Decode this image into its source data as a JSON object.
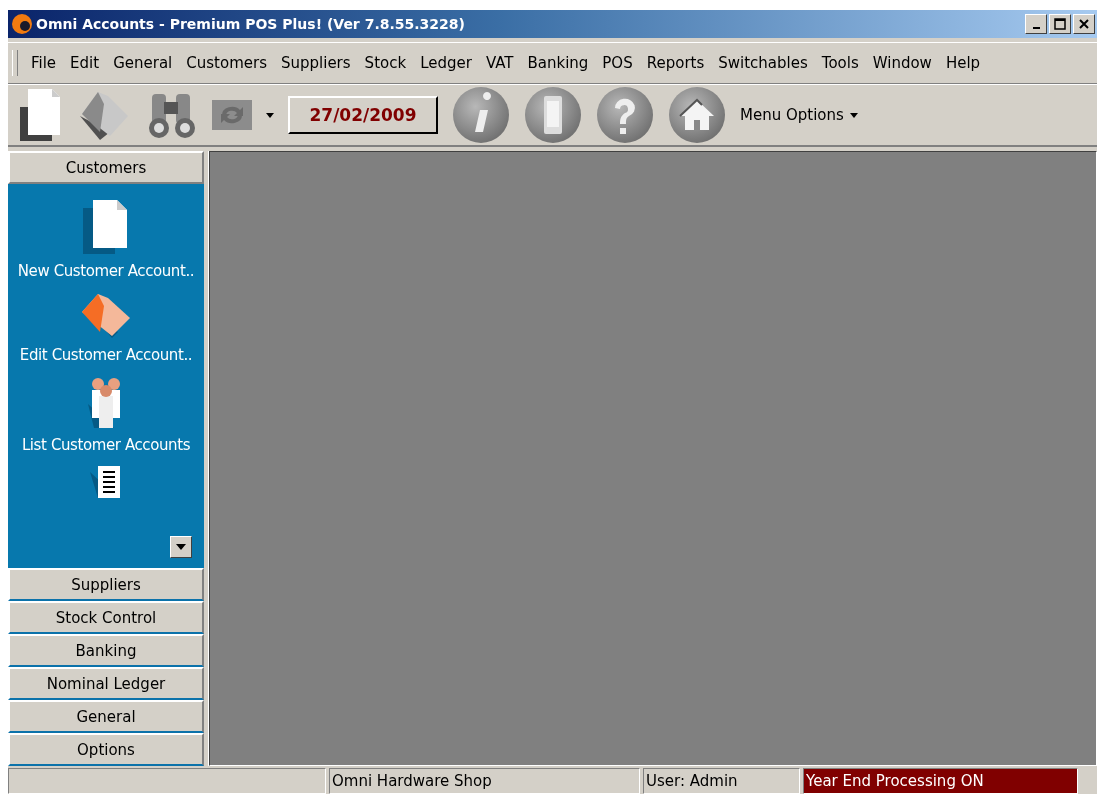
{
  "window": {
    "title": "Omni Accounts - Premium POS Plus!  (Ver 7.8.55.3228)"
  },
  "menu": [
    "File",
    "Edit",
    "General",
    "Customers",
    "Suppliers",
    "Stock",
    "Ledger",
    "VAT",
    "Banking",
    "POS",
    "Reports",
    "Switchables",
    "Tools",
    "Window",
    "Help"
  ],
  "toolbar": {
    "date": "27/02/2009",
    "menu_options": "Menu Options"
  },
  "sidebar": {
    "groups": [
      {
        "label": "Customers",
        "expanded": true,
        "items": [
          {
            "label": "New Customer Account..",
            "kind": "new"
          },
          {
            "label": "Edit Customer Account..",
            "kind": "edit"
          },
          {
            "label": "List Customer Accounts",
            "kind": "list"
          }
        ]
      },
      {
        "label": "Suppliers",
        "expanded": false
      },
      {
        "label": "Stock Control",
        "expanded": false
      },
      {
        "label": "Banking",
        "expanded": false
      },
      {
        "label": "Nominal Ledger",
        "expanded": false
      },
      {
        "label": "General",
        "expanded": false
      },
      {
        "label": "Options",
        "expanded": false
      }
    ]
  },
  "status_bar": [
    {
      "text": "Omni Hardware Shop",
      "kind": "plain"
    },
    {
      "text": "User: Admin",
      "kind": "plain"
    },
    {
      "text": "Year End Processing ON",
      "kind": "alert"
    }
  ]
}
